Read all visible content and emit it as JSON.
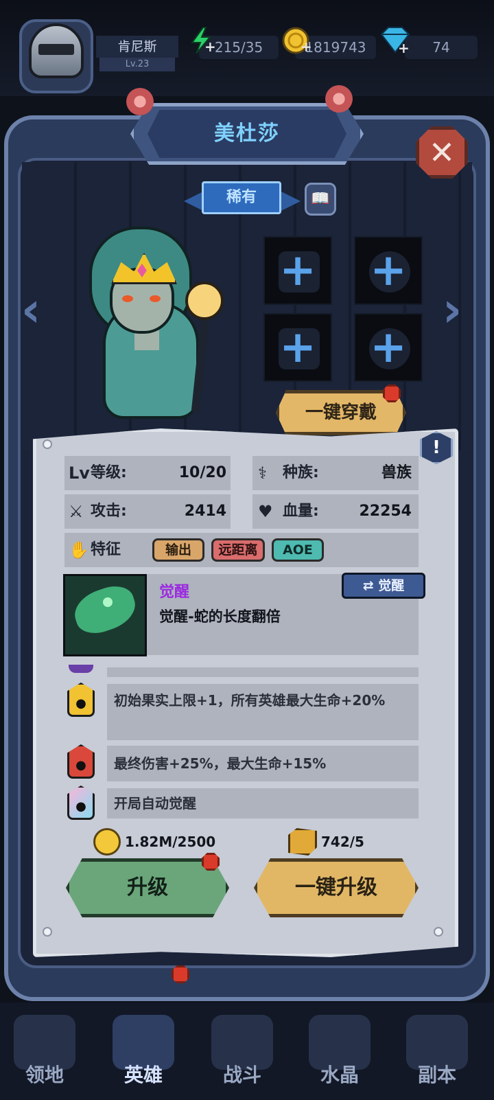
{
  "player": {
    "name": "肯尼斯",
    "level": "Lv.23"
  },
  "resources": {
    "energy": "215/35",
    "gold": "1819743",
    "gems": "74"
  },
  "hero": {
    "name": "美杜莎",
    "rarity": "稀有",
    "equip_all_label": "一键穿戴",
    "stats": {
      "level_label": "等级:",
      "level_value": "10/20",
      "race_label": "种族:",
      "race_value": "兽族",
      "attack_label": "攻击:",
      "attack_value": "2414",
      "hp_label": "血量:",
      "hp_value": "22254",
      "traits_label": "特征",
      "traits": [
        "输出",
        "远距离",
        "AOE"
      ]
    },
    "skill": {
      "name": "觉醒",
      "description": "觉醒-蛇的长度翻倍",
      "button_label": "觉醒"
    },
    "perks": [
      {
        "text": "初始果实上限+1，所有英雄最大生命+20%"
      },
      {
        "text": "最终伤害+25%，最大生命+15%"
      },
      {
        "text": "开局自动觉醒"
      }
    ],
    "cost_gold": "1.82M/2500",
    "cost_ore": "742/5",
    "upgrade_label": "升级",
    "upgrade_all_label": "一键升级"
  },
  "nav": {
    "items": [
      {
        "label": "领地"
      },
      {
        "label": "英雄"
      },
      {
        "label": "战斗"
      },
      {
        "label": "水晶"
      },
      {
        "label": "副本"
      }
    ]
  },
  "colors": {
    "title_text": "#7fd1ff",
    "paper": "#c7ccd6",
    "upgrade_green": "#6aa67a",
    "upgrade_gold": "#e1b766",
    "awaken_purple": "#9b2ae0"
  }
}
